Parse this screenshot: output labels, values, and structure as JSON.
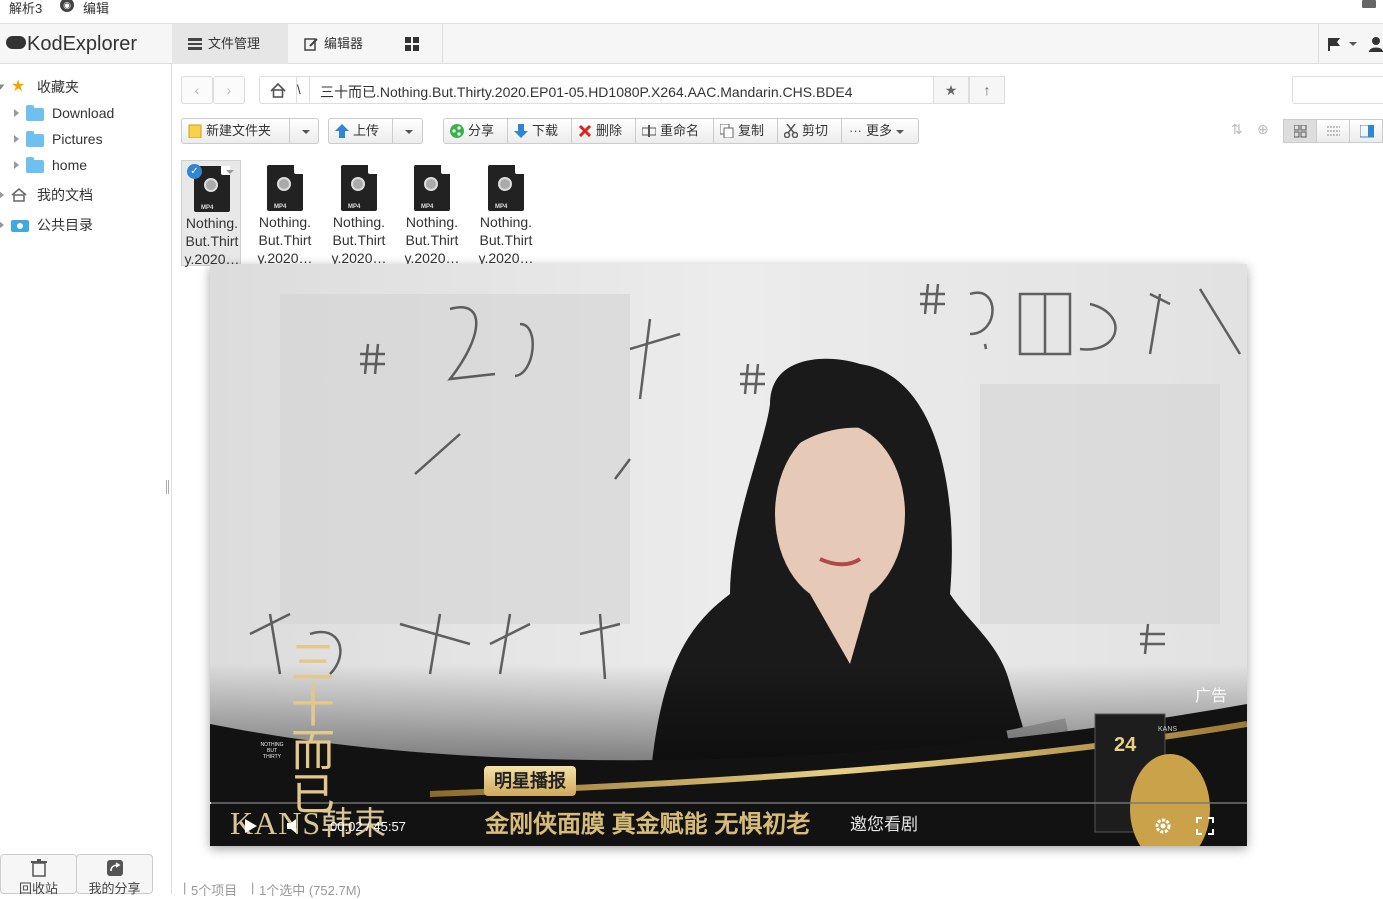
{
  "topbar": {
    "item1": "解析3",
    "item2": "编辑"
  },
  "app": {
    "logo_text": "KodExplorer"
  },
  "nav": {
    "file_manager": "文件管理",
    "editor": "编辑器"
  },
  "sidebar": {
    "favorites": "收藏夹",
    "items": [
      {
        "label": "Download"
      },
      {
        "label": "Pictures"
      },
      {
        "label": "home"
      }
    ],
    "my_docs": "我的文档",
    "public_dir": "公共目录",
    "recycle": "回收站",
    "my_share": "我的分享"
  },
  "path": {
    "partial": "\\",
    "current": "三十而已.Nothing.But.Thirty.2020.EP01-05.HD1080P.X264.AAC.Mandarin.CHS.BDE4"
  },
  "toolbar": {
    "new_folder": "新建文件夹",
    "upload": "上传",
    "share": "分享",
    "download": "下载",
    "delete": "删除",
    "rename": "重命名",
    "copy": "复制",
    "cut": "剪切",
    "more": "更多"
  },
  "files": [
    {
      "line1": "Nothing.",
      "line2": "But.Thirt",
      "line3": "y.2020…",
      "selected": true
    },
    {
      "line1": "Nothing.",
      "line2": "But.Thirt",
      "line3": "y.2020…",
      "selected": false
    },
    {
      "line1": "Nothing.",
      "line2": "But.Thirt",
      "line3": "y.2020…",
      "selected": false
    },
    {
      "line1": "Nothing.",
      "line2": "But.Thirt",
      "line3": "y.2020…",
      "selected": false
    },
    {
      "line1": "Nothing.",
      "line2": "But.Thirt",
      "line3": "y.2020…",
      "selected": false
    }
  ],
  "player": {
    "ad_label": "广告",
    "time": "00:02 / 45:57",
    "brand": "KANS韩束",
    "ad_tag": "明星播报",
    "ad_slogan": "金刚侠面膜 真金赋能 无惧初老",
    "ad_cta": "邀您看剧",
    "show_logo": "三十而已",
    "show_logo_sub": "NOTHING BUT THIRTY",
    "product_num": "24",
    "product_brand": "KANS",
    "progress": 0.0007
  },
  "statusbar": {
    "count": "5个项目",
    "selected": "1个选中 (752.7M)"
  }
}
